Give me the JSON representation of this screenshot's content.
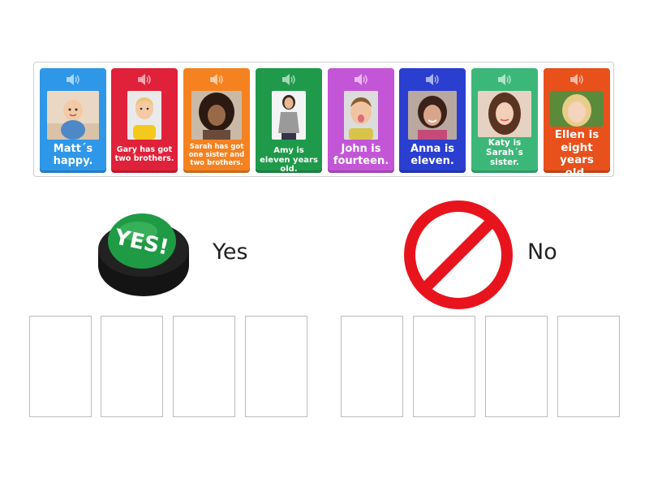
{
  "cards": [
    {
      "caption": "Matt´s happy.",
      "color": "#2f97e8",
      "photo": "baby-photo"
    },
    {
      "caption": "Gary has got two brothers.",
      "color": "#e0213a",
      "photo": "boy-photo"
    },
    {
      "caption": "Sarah has got one sister and two brothers.",
      "color": "#f58220",
      "photo": "girl-curly-photo"
    },
    {
      "caption": "Amy is eleven years old.",
      "color": "#1f9a4a",
      "photo": "woman-photo"
    },
    {
      "caption": "John is fourteen.",
      "color": "#c356d6",
      "photo": "boy-tongue-photo"
    },
    {
      "caption": "Anna is eleven.",
      "color": "#2a3fd0",
      "photo": "girl-smile-photo"
    },
    {
      "caption": "Katy is Sarah´s sister.",
      "color": "#3cb77a",
      "photo": "teen-girl-photo"
    },
    {
      "caption": "Ellen is eight years old.",
      "color": "#e8501c",
      "photo": "blonde-girl-photo"
    }
  ],
  "categories": {
    "yes": {
      "label": "Yes",
      "button_text": "YES!"
    },
    "no": {
      "label": "No"
    }
  }
}
